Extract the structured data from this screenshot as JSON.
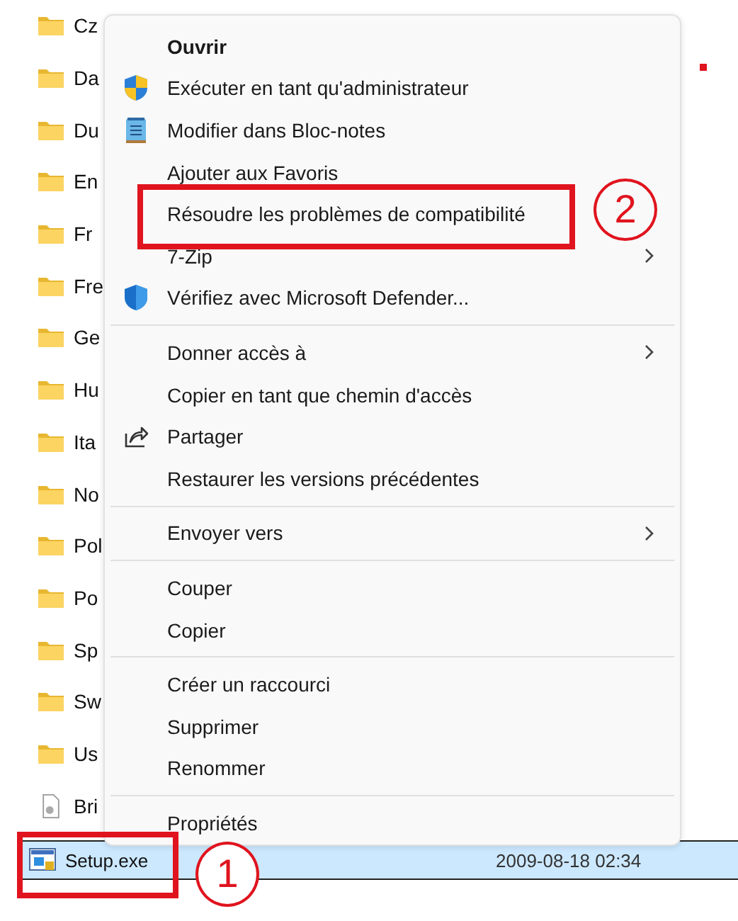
{
  "files": [
    {
      "name": "Cz",
      "kind": "folder",
      "selected": false
    },
    {
      "name": "Da",
      "kind": "folder",
      "selected": false
    },
    {
      "name": "Du",
      "kind": "folder",
      "selected": false
    },
    {
      "name": "En",
      "kind": "folder",
      "selected": false
    },
    {
      "name": "Fr",
      "kind": "folder",
      "selected": false
    },
    {
      "name": "Fre",
      "kind": "folder",
      "selected": false
    },
    {
      "name": "Ge",
      "kind": "folder",
      "selected": false
    },
    {
      "name": "Hu",
      "kind": "folder",
      "selected": false
    },
    {
      "name": "Ita",
      "kind": "folder",
      "selected": false
    },
    {
      "name": "No",
      "kind": "folder",
      "selected": false
    },
    {
      "name": "Pol",
      "kind": "folder",
      "selected": false
    },
    {
      "name": "Po",
      "kind": "folder",
      "selected": false
    },
    {
      "name": "Sp",
      "kind": "folder",
      "selected": false
    },
    {
      "name": "Sw",
      "kind": "folder",
      "selected": false
    },
    {
      "name": "Us",
      "kind": "folder",
      "selected": false
    },
    {
      "name": "Bri",
      "kind": "file",
      "selected": false
    },
    {
      "name": "Setup.exe",
      "kind": "exe",
      "selected": true,
      "date": "2009-08-18 02:34"
    }
  ],
  "context_menu": [
    {
      "kind": "item",
      "label": "Ouvrir",
      "bold": true,
      "submenu": false
    },
    {
      "kind": "item",
      "label": "Exécuter en tant qu'administrateur",
      "bold": false,
      "submenu": false
    },
    {
      "kind": "item",
      "label": "Modifier dans Bloc-notes",
      "bold": false,
      "submenu": false
    },
    {
      "kind": "item",
      "label": "Ajouter aux Favoris",
      "bold": false,
      "submenu": false
    },
    {
      "kind": "item",
      "label": "Résoudre les problèmes de compatibilité",
      "bold": false,
      "submenu": false
    },
    {
      "kind": "item",
      "label": "7-Zip",
      "bold": false,
      "submenu": true
    },
    {
      "kind": "item",
      "label": "Vérifiez avec Microsoft Defender...",
      "bold": false,
      "submenu": false
    },
    {
      "kind": "separator"
    },
    {
      "kind": "item",
      "label": "Donner accès à",
      "bold": false,
      "submenu": true
    },
    {
      "kind": "item",
      "label": "Copier en tant que chemin d'accès",
      "bold": false,
      "submenu": false
    },
    {
      "kind": "item",
      "label": "Partager",
      "bold": false,
      "submenu": false
    },
    {
      "kind": "item",
      "label": "Restaurer les versions précédentes",
      "bold": false,
      "submenu": false
    },
    {
      "kind": "separator"
    },
    {
      "kind": "item",
      "label": "Envoyer vers",
      "bold": false,
      "submenu": true
    },
    {
      "kind": "separator"
    },
    {
      "kind": "item",
      "label": "Couper",
      "bold": false,
      "submenu": false
    },
    {
      "kind": "item",
      "label": "Copier",
      "bold": false,
      "submenu": false
    },
    {
      "kind": "separator"
    },
    {
      "kind": "item",
      "label": "Créer un raccourci",
      "bold": false,
      "submenu": false
    },
    {
      "kind": "item",
      "label": "Supprimer",
      "bold": false,
      "submenu": false
    },
    {
      "kind": "item",
      "label": "Renommer",
      "bold": false,
      "submenu": false
    },
    {
      "kind": "separator"
    },
    {
      "kind": "item",
      "label": "Propriétés",
      "bold": false,
      "submenu": false
    }
  ],
  "annotations": [
    {
      "number": "2"
    },
    {
      "number": "1"
    }
  ]
}
